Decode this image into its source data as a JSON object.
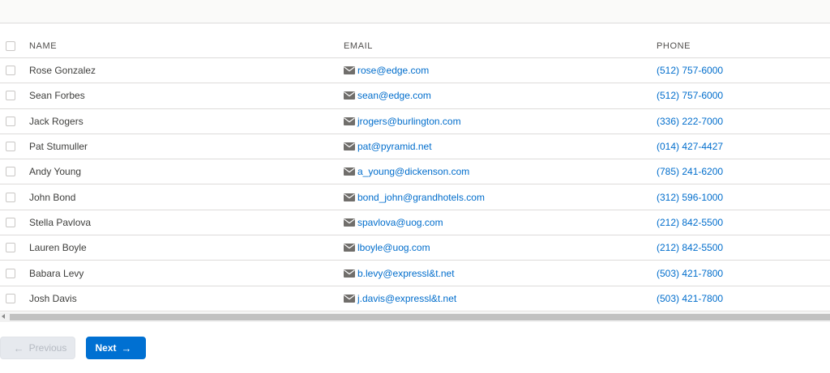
{
  "table": {
    "columns": {
      "name": "NAME",
      "email": "EMAIL",
      "phone": "PHONE"
    },
    "rows": [
      {
        "name": "Rose Gonzalez",
        "email": "rose@edge.com",
        "phone": "(512) 757-6000"
      },
      {
        "name": "Sean Forbes",
        "email": "sean@edge.com",
        "phone": "(512) 757-6000"
      },
      {
        "name": "Jack Rogers",
        "email": "jrogers@burlington.com",
        "phone": "(336) 222-7000"
      },
      {
        "name": "Pat Stumuller",
        "email": "pat@pyramid.net",
        "phone": "(014) 427-4427"
      },
      {
        "name": "Andy Young",
        "email": "a_young@dickenson.com",
        "phone": "(785) 241-6200"
      },
      {
        "name": "John Bond",
        "email": "bond_john@grandhotels.com",
        "phone": "(312) 596-1000"
      },
      {
        "name": "Stella Pavlova",
        "email": "spavlova@uog.com",
        "phone": "(212) 842-5500"
      },
      {
        "name": "Lauren Boyle",
        "email": "lboyle@uog.com",
        "phone": "(212) 842-5500"
      },
      {
        "name": "Babara Levy",
        "email": "b.levy@expressl&t.net",
        "phone": "(503) 421-7800"
      },
      {
        "name": "Josh Davis",
        "email": "j.davis@expressl&t.net",
        "phone": "(503) 421-7800"
      }
    ]
  },
  "pagination": {
    "previous_label": "Previous",
    "next_label": "Next",
    "previous_arrow": "←",
    "next_arrow": "→"
  },
  "icons": {
    "email": "envelope-icon"
  },
  "colors": {
    "link": "#006dcc",
    "primary_button": "#0070d2",
    "disabled_button": "#e6e9ee"
  }
}
